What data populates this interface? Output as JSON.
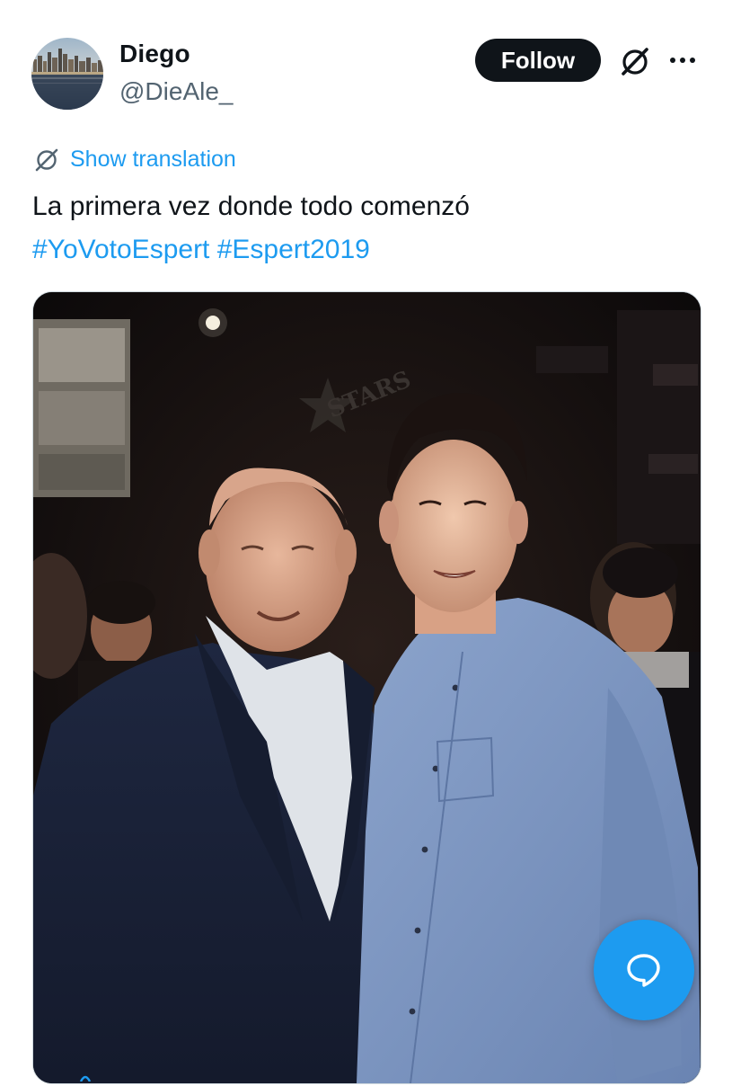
{
  "author": {
    "display_name": "Diego",
    "handle": "@DieAle_",
    "avatar_icon": "city-skyline-avatar"
  },
  "header": {
    "follow_label": "Follow",
    "grok_icon": "grok-slash-circle-icon",
    "more_icon": "more-dots-icon"
  },
  "tweet": {
    "translation_label": "Show translation",
    "text": "La primera vez donde todo comenzó",
    "hashtags": [
      "#YoVotoEspert",
      "#Espert2019"
    ]
  },
  "media": {
    "kind": "photo",
    "photo_sign_text": "STARS"
  },
  "fab": {
    "icon": "reply-bubble-icon"
  },
  "colors": {
    "link": "#1d9bf0",
    "primary_text": "#0f1419",
    "secondary_text": "#536471",
    "follow_bg": "#0f1419",
    "fab_bg": "#1d9bf0"
  }
}
